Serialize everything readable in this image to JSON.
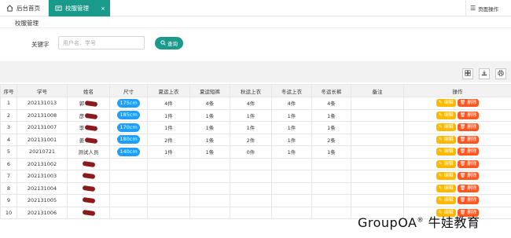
{
  "tabs": {
    "home_label": "后台首页",
    "active_label": "校服管理",
    "close": "×",
    "page_ops_label": "页面操作"
  },
  "panel": {
    "title": "校服管理"
  },
  "search": {
    "label": "关键字",
    "placeholder": "用户名、学号",
    "button_label": "查询"
  },
  "table": {
    "columns": [
      "序号",
      "学号",
      "姓名",
      "尺寸",
      "夏运上衣",
      "夏运短裤",
      "秋运上衣",
      "冬运上衣",
      "冬运长裤",
      "备注",
      "操作"
    ],
    "edit_label": "编辑",
    "delete_label": "删除",
    "rows": [
      {
        "no": "1",
        "sid": "202131013",
        "name": "郭",
        "size": "175cm",
        "c1": "4件",
        "c2": "4条",
        "c3": "4件",
        "c4": "4件",
        "c5": "4条",
        "note": ""
      },
      {
        "no": "2",
        "sid": "202131008",
        "name": "彦",
        "size": "185cm",
        "c1": "1件",
        "c2": "1条",
        "c3": "1件",
        "c4": "1件",
        "c5": "1条",
        "note": ""
      },
      {
        "no": "3",
        "sid": "202131007",
        "name": "李",
        "size": "170cm",
        "c1": "1件",
        "c2": "1条",
        "c3": "1件",
        "c4": "1件",
        "c5": "1条",
        "note": ""
      },
      {
        "no": "4",
        "sid": "202131001",
        "name": "姜",
        "size": "180cm",
        "c1": "2件",
        "c2": "1条",
        "c3": "2件",
        "c4": "1件",
        "c5": "2条",
        "note": ""
      },
      {
        "no": "5",
        "sid": "20210721",
        "name": "测试人员",
        "size": "140cm",
        "c1": "1件",
        "c2": "1条",
        "c3": "0件",
        "c4": "1件",
        "c5": "1条",
        "note": ""
      },
      {
        "no": "6",
        "sid": "202131002",
        "name": "",
        "size": "",
        "c1": "",
        "c2": "",
        "c3": "",
        "c4": "",
        "c5": "",
        "note": ""
      },
      {
        "no": "7",
        "sid": "202131003",
        "name": "",
        "size": "",
        "c1": "",
        "c2": "",
        "c3": "",
        "c4": "",
        "c5": "",
        "note": ""
      },
      {
        "no": "8",
        "sid": "202131004",
        "name": "",
        "size": "",
        "c1": "",
        "c2": "",
        "c3": "",
        "c4": "",
        "c5": "",
        "note": ""
      },
      {
        "no": "9",
        "sid": "202131005",
        "name": "",
        "size": "",
        "c1": "",
        "c2": "",
        "c3": "",
        "c4": "",
        "c5": "",
        "note": ""
      },
      {
        "no": "10",
        "sid": "202131006",
        "name": "",
        "size": "",
        "c1": "",
        "c2": "",
        "c3": "",
        "c4": "",
        "c5": "",
        "note": ""
      }
    ]
  },
  "watermark": {
    "text": "GroupOA",
    "mark": "®",
    "suffix": " 牛娃教育"
  }
}
